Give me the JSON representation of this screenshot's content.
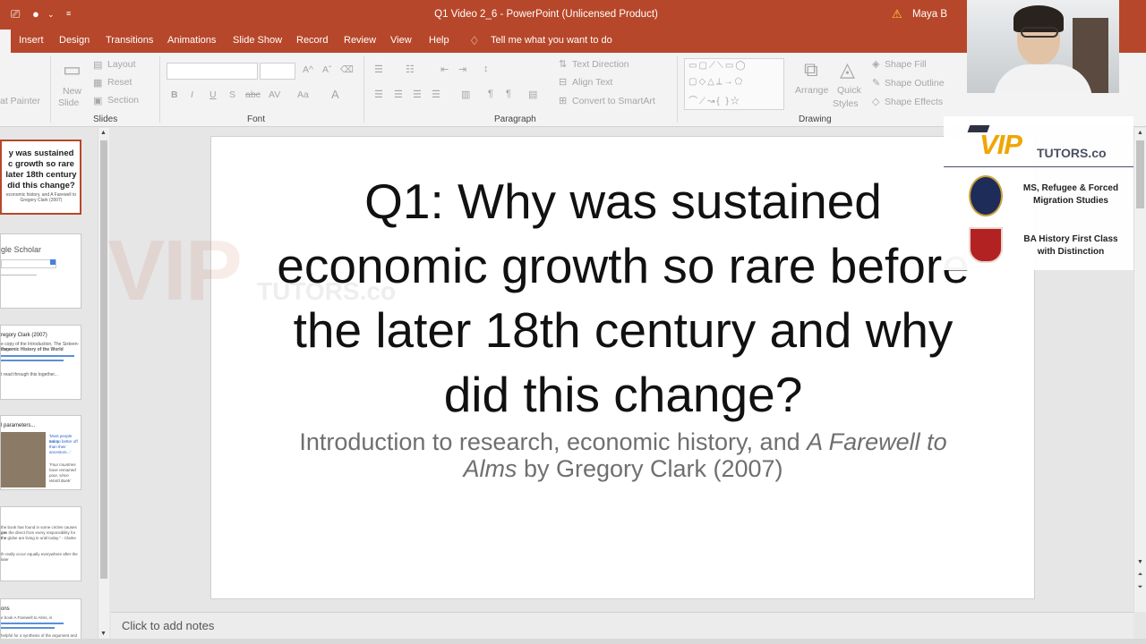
{
  "window": {
    "title": "Q1 Video 2_6  -  PowerPoint (Unlicensed Product)",
    "user": "Maya B"
  },
  "tabs": [
    "Insert",
    "Design",
    "Transitions",
    "Animations",
    "Slide Show",
    "Record",
    "Review",
    "View",
    "Help"
  ],
  "tell_me": "Tell me what you want to do",
  "ribbon": {
    "clipboard": {
      "format_painter": "at Painter"
    },
    "slides": {
      "new_slide_1": "New",
      "new_slide_2": "Slide",
      "layout": "Layout",
      "reset": "Reset",
      "section": "Section",
      "label": "Slides"
    },
    "font": {
      "label": "Font",
      "bold": "B",
      "italic": "I",
      "underline": "U",
      "shadow": "S",
      "strike": "abc",
      "spacing": "AV",
      "case": "Aa",
      "color": "A"
    },
    "paragraph": {
      "label": "Paragraph",
      "text_direction": "Text Direction",
      "align_text": "Align Text",
      "convert_smartart": "Convert to SmartArt"
    },
    "drawing": {
      "label": "Drawing",
      "arrange": "Arrange",
      "quick_styles_1": "Quick",
      "quick_styles_2": "Styles",
      "shape_fill": "Shape Fill",
      "shape_outline": "Shape Outline",
      "shape_effects": "Shape Effects"
    }
  },
  "thumbnails": {
    "t1": {
      "line1": "y was sustained",
      "line2": "c growth so rare",
      "line3": "later 18th century",
      "line4": "did this change?",
      "sub1": "economic history, and A Farewell to",
      "sub2": "Gregory Clark (2007)"
    },
    "t2": {
      "title": "gle Scholar"
    },
    "t3": {
      "title": "regory Clark (2007)",
      "body1": "e copy of the Introduction, The Sixteen-Page",
      "body2": "conomic History of the World",
      "body3": "t read through this together..."
    },
    "t4": {
      "title": "l parameters...",
      "caption1": "'Most people today",
      "caption2": "are no better off",
      "caption3": "than their",
      "caption4": "ancestors...'",
      "quote1": "'Four countries",
      "quote2": "have remained",
      "quote3": "poor, since",
      "quote4": "World Bank'"
    },
    "t5": {
      "body1": "the book has found in some circles causes me",
      "body2": "ges the direct from every responsibility for the",
      "body3": "the globe are living in until today.'' - Clarke",
      "body4": "th really occur equally everywhere after the later"
    },
    "t6": {
      "title": "ons",
      "body1": "e book A Farewell to Alms, is",
      "body2": "helpful for a synthesis of the argument and critique"
    }
  },
  "slide": {
    "title": "Q1: Why was sustained economic growth so rare before the later 18th century and why did this change?",
    "subtitle_pre": "Introduction to research, economic history, and ",
    "subtitle_italic1": "A Farewell to",
    "subtitle_italic2": "Alms",
    "subtitle_post": " by Gregory Clark (2007)"
  },
  "notes_placeholder": "Click to add notes",
  "watermark": {
    "vip": "VIP",
    "tutors": "TUTORS.co"
  },
  "branding": {
    "logo_vip": "VIP",
    "logo_tutors": "TUTORS.co",
    "credential_1_line1": "MS, Refugee & Forced",
    "credential_1_line2": "Migration Studies",
    "credential_2_line1": "BA History First Class",
    "credential_2_line2": "with Distinction"
  },
  "colors": {
    "accent": "#b7472a",
    "logo_orange": "#f0a500",
    "logo_navy": "#4b4f63"
  }
}
